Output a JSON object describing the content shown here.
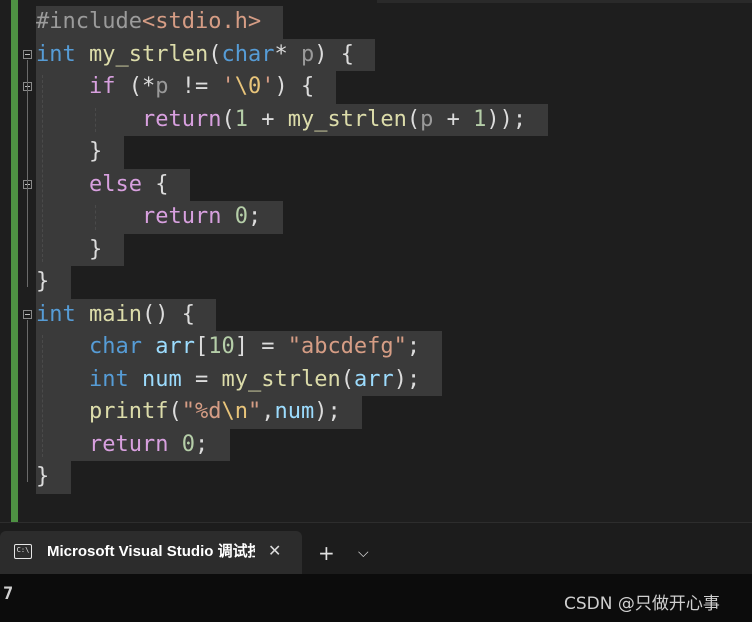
{
  "editor": {
    "lines": [
      [
        {
          "t": "#include",
          "c": "pre"
        },
        {
          "t": "<stdio.h>",
          "c": "inc"
        }
      ],
      [
        {
          "t": "int",
          "c": "kw"
        },
        {
          "t": " ",
          "c": "txt"
        },
        {
          "t": "my_strlen",
          "c": "fn"
        },
        {
          "t": "(",
          "c": "txt"
        },
        {
          "t": "char",
          "c": "kw"
        },
        {
          "t": "* ",
          "c": "txt"
        },
        {
          "t": "p",
          "c": "par"
        },
        {
          "t": ") {",
          "c": "txt"
        }
      ],
      [
        {
          "t": "    ",
          "c": "txt"
        },
        {
          "t": "if",
          "c": "ctl"
        },
        {
          "t": " (*",
          "c": "txt"
        },
        {
          "t": "p",
          "c": "par"
        },
        {
          "t": " != ",
          "c": "txt"
        },
        {
          "t": "'",
          "c": "str"
        },
        {
          "t": "\\0",
          "c": "esc"
        },
        {
          "t": "'",
          "c": "str"
        },
        {
          "t": ") {",
          "c": "txt"
        }
      ],
      [
        {
          "t": "        ",
          "c": "txt"
        },
        {
          "t": "return",
          "c": "ctl"
        },
        {
          "t": "(",
          "c": "txt"
        },
        {
          "t": "1",
          "c": "num"
        },
        {
          "t": " + ",
          "c": "txt"
        },
        {
          "t": "my_strlen",
          "c": "fn"
        },
        {
          "t": "(",
          "c": "txt"
        },
        {
          "t": "p",
          "c": "par"
        },
        {
          "t": " + ",
          "c": "txt"
        },
        {
          "t": "1",
          "c": "num"
        },
        {
          "t": "));",
          "c": "txt"
        }
      ],
      [
        {
          "t": "    }",
          "c": "txt"
        }
      ],
      [
        {
          "t": "    ",
          "c": "txt"
        },
        {
          "t": "else",
          "c": "ctl"
        },
        {
          "t": " {",
          "c": "txt"
        }
      ],
      [
        {
          "t": "        ",
          "c": "txt"
        },
        {
          "t": "return",
          "c": "ctl"
        },
        {
          "t": " ",
          "c": "txt"
        },
        {
          "t": "0",
          "c": "num"
        },
        {
          "t": ";",
          "c": "txt"
        }
      ],
      [
        {
          "t": "    }",
          "c": "txt"
        }
      ],
      [
        {
          "t": "}",
          "c": "txt"
        }
      ],
      [
        {
          "t": "int",
          "c": "kw"
        },
        {
          "t": " ",
          "c": "txt"
        },
        {
          "t": "main",
          "c": "fn"
        },
        {
          "t": "() {",
          "c": "txt"
        }
      ],
      [
        {
          "t": "    ",
          "c": "txt"
        },
        {
          "t": "char",
          "c": "kw"
        },
        {
          "t": " ",
          "c": "txt"
        },
        {
          "t": "arr",
          "c": "var"
        },
        {
          "t": "[",
          "c": "txt"
        },
        {
          "t": "10",
          "c": "num"
        },
        {
          "t": "] = ",
          "c": "txt"
        },
        {
          "t": "\"abcdefg\"",
          "c": "str"
        },
        {
          "t": ";",
          "c": "txt"
        }
      ],
      [
        {
          "t": "    ",
          "c": "txt"
        },
        {
          "t": "int",
          "c": "kw"
        },
        {
          "t": " ",
          "c": "txt"
        },
        {
          "t": "num",
          "c": "var"
        },
        {
          "t": " = ",
          "c": "txt"
        },
        {
          "t": "my_strlen",
          "c": "fn"
        },
        {
          "t": "(",
          "c": "txt"
        },
        {
          "t": "arr",
          "c": "var"
        },
        {
          "t": ");",
          "c": "txt"
        }
      ],
      [
        {
          "t": "    ",
          "c": "txt"
        },
        {
          "t": "printf",
          "c": "fn"
        },
        {
          "t": "(",
          "c": "txt"
        },
        {
          "t": "\"%d",
          "c": "str"
        },
        {
          "t": "\\n",
          "c": "esc"
        },
        {
          "t": "\"",
          "c": "str"
        },
        {
          "t": ",",
          "c": "txt"
        },
        {
          "t": "num",
          "c": "var"
        },
        {
          "t": ");",
          "c": "txt"
        }
      ],
      [
        {
          "t": "    ",
          "c": "txt"
        },
        {
          "t": "return",
          "c": "ctl"
        },
        {
          "t": " ",
          "c": "txt"
        },
        {
          "t": "0",
          "c": "num"
        },
        {
          "t": ";",
          "c": "txt"
        }
      ],
      [
        {
          "t": "}",
          "c": "txt"
        }
      ]
    ]
  },
  "terminal": {
    "tab_title": "Microsoft Visual Studio 调试控制台",
    "tab_icon": "C:\\",
    "close_glyph": "✕",
    "new_tab_glyph": "+",
    "menu_glyph": "⌵",
    "output": "7"
  },
  "watermark": "CSDN @只做开心事"
}
